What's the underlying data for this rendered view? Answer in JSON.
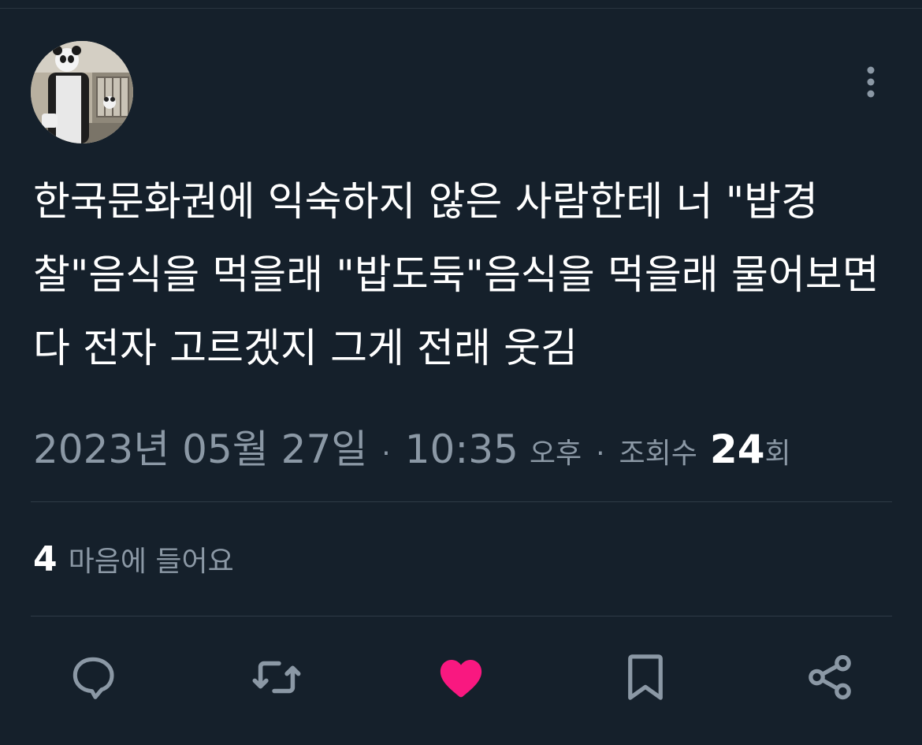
{
  "tweet": {
    "avatar_icon": "user-avatar-panda-costume",
    "text": "한국문화권에 익숙하지 않은 사람한테 너 \"밥경\n찰\"음식을 먹을래 \"밥도둑\"음식을 먹을래 물어보면\n다 전자 고르겠지 그게 전래 웃김",
    "date": "2023년 05월 27일",
    "time": "10:35",
    "ampm": "오후",
    "separator": "·",
    "views_label": "조회수",
    "views_count": "24",
    "views_suffix": "회",
    "likes_count": "4",
    "likes_label": "마음에 들어요"
  },
  "actions": [
    {
      "name": "reply",
      "icon": "speech-bubble-icon"
    },
    {
      "name": "retweet",
      "icon": "retweet-icon"
    },
    {
      "name": "like",
      "icon": "heart-icon",
      "active": true
    },
    {
      "name": "bookmark",
      "icon": "bookmark-icon"
    },
    {
      "name": "share",
      "icon": "share-icon"
    }
  ],
  "colors": {
    "background": "#15202b",
    "text": "#ffffff",
    "muted": "#8b98a5",
    "like_active": "#f91880",
    "icon": "#8b98a5"
  }
}
